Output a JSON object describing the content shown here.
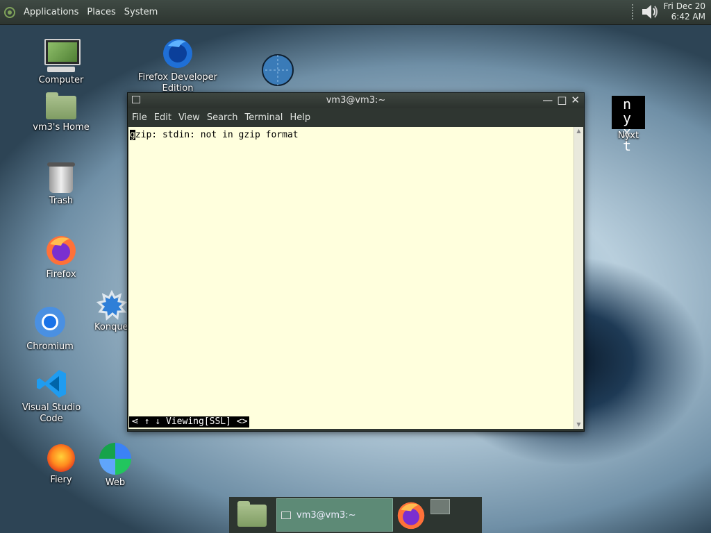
{
  "topbar": {
    "menus": [
      "Applications",
      "Places",
      "System"
    ],
    "clock_date": "Fri Dec 20",
    "clock_time": "6:42 AM"
  },
  "desktop": {
    "computer": "Computer",
    "firefox_dev_line1": "Firefox Developer",
    "firefox_dev_line2": "Edition",
    "home": "vm3's Home",
    "trash": "Trash",
    "firefox": "Firefox",
    "konqueror": "Konque",
    "chromium": "Chromium",
    "vscode": "Visual Studio Code",
    "fiery": "Fiery",
    "web": "Web",
    "nyxt": "Nyxt",
    "nyxt_logo_line1": "n y",
    "nyxt_logo_line2": "x t"
  },
  "terminal": {
    "title": "vm3@vm3:~",
    "menu": [
      "File",
      "Edit",
      "View",
      "Search",
      "Terminal",
      "Help"
    ],
    "cursor_char": "g",
    "line1_rest": "zip: stdin: not in gzip format",
    "status": "⋖ ↑ ↓ Viewing[SSL] <>"
  },
  "taskbar": {
    "task_label": "vm3@vm3:~"
  },
  "colors": {
    "terminal_bg": "#ffffdd",
    "panel": "#2d3530",
    "task_active": "#5d8a76"
  }
}
